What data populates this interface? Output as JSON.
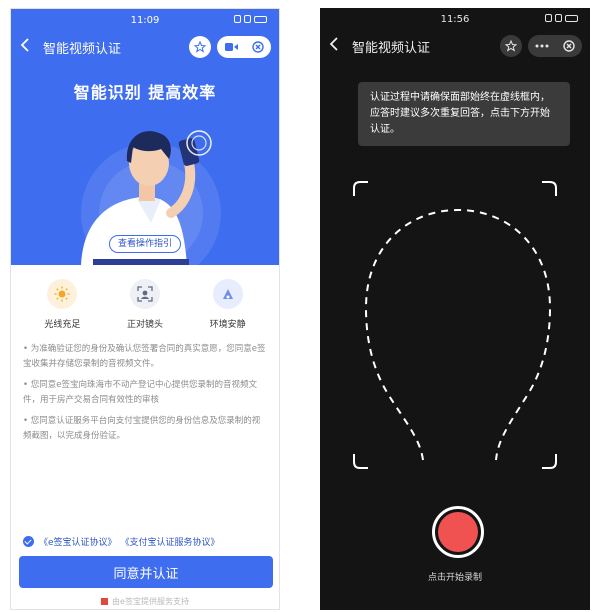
{
  "left": {
    "status_time": "11:09",
    "nav_title": "智能视频认证",
    "hero_title": "智能识别  提高效率",
    "guide_button": "查看操作指引",
    "features": [
      {
        "label": "光线充足",
        "icon": "sun-icon"
      },
      {
        "label": "正对镜头",
        "icon": "face-scan-icon"
      },
      {
        "label": "环境安静",
        "icon": "quiet-icon"
      }
    ],
    "notes": [
      "• 为准确验证您的身份及确认您签署合同的真实意愿，您同意e签宝收集并存储您录制的音视频文件。",
      "• 您同意e签宝向珠海市不动产登记中心提供您录制的音视频文件，用于房产交易合同有效性的审核",
      "• 您同意认证服务平台向支付宝提供您的身份信息及您录制的视频截图，以完成身份验证。"
    ],
    "agreement_link_1": "《e签宝认证协议》",
    "agreement_link_2": "《支付宝认证服务协议》",
    "primary_button": "同意并认证",
    "footer": "由e签宝提供服务支持"
  },
  "right": {
    "status_time": "11:56",
    "nav_title": "智能视频认证",
    "tooltip": "认证过程中请确保面部始终在虚线框内，应答时建议多次重复回答，点击下方开始认证。",
    "record_label": "点击开始录制"
  },
  "colors": {
    "brand_blue": "#3f6df0",
    "record_red": "#f05252",
    "dark_bg": "#141414"
  }
}
